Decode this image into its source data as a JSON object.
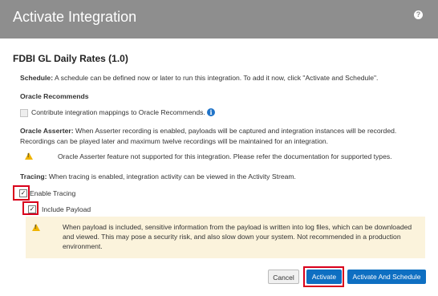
{
  "header": {
    "title": "Activate Integration",
    "help_icon": "?"
  },
  "integration": {
    "title": "FDBI GL Daily Rates (1.0)"
  },
  "schedule": {
    "label": "Schedule:",
    "text": "A schedule can be defined now or later to run this integration. To add it now, click \"Activate and Schedule\"."
  },
  "oracle_recommends": {
    "heading": "Oracle Recommends",
    "checkbox_label": "Contribute integration mappings to Oracle Recommends.",
    "checked": false,
    "info_icon": "i"
  },
  "asserter": {
    "label": "Oracle Asserter:",
    "line1": "When Asserter recording is enabled, payloads will be captured and integration instances will be recorded.",
    "line2": "Recordings can be played later and maximum twelve recordings will be maintained for an integration.",
    "warning": "Oracle Asserter feature not supported for this integration. Please refer the documentation for supported types."
  },
  "tracing": {
    "label": "Tracing:",
    "text": "When tracing is enabled, integration activity can be viewed in the Activity Stream.",
    "enable_label": "Enable Tracing",
    "enable_checked": true,
    "payload_label": "Include Payload",
    "payload_checked": true
  },
  "payload_warning": {
    "line1": "When payload is included, sensitive information from the payload is written into log files, which can be downloaded",
    "line2": "and viewed. This may pose a security risk, and also slow down your system. Not recommended in a production",
    "line3": "environment."
  },
  "buttons": {
    "cancel": "Cancel",
    "activate": "Activate",
    "activate_schedule": "Activate And Schedule"
  },
  "colors": {
    "header": "#8e8e8e",
    "primary": "#0e6fc2",
    "highlight": "#d9001b",
    "warning_bg": "#fbf3dc",
    "warning_icon": "#f0b400"
  }
}
